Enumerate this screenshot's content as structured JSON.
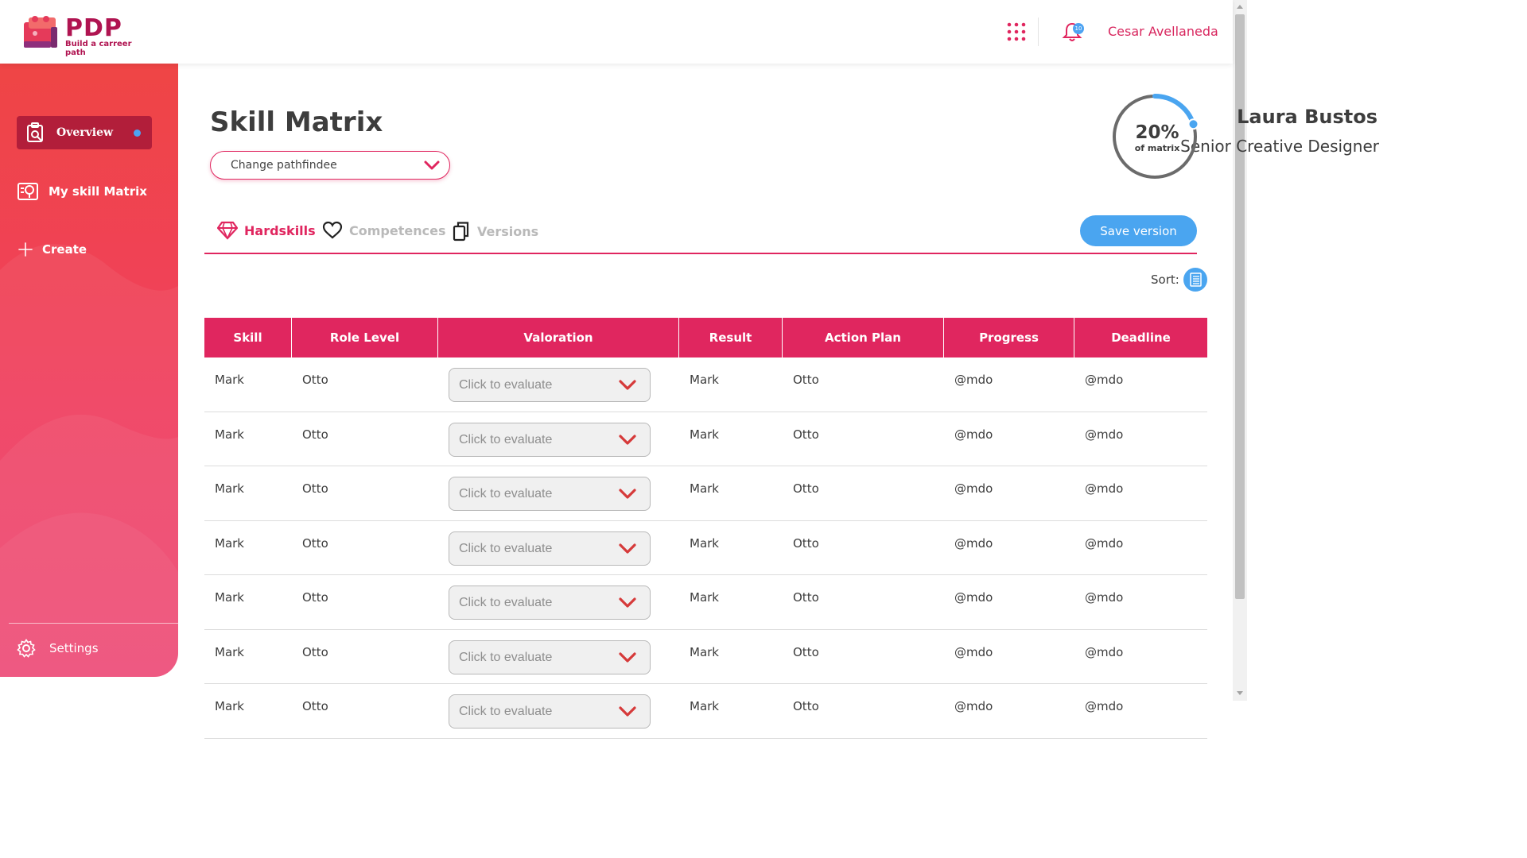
{
  "header": {
    "logo_text": "PDP",
    "logo_tagline": "Build a carreer path",
    "notification_count": "10",
    "user_name": "Cesar Avellaneda"
  },
  "sidebar": {
    "items": [
      {
        "label": "Overview",
        "active": true,
        "icon": "overview-icon"
      },
      {
        "label": "My skill Matrix",
        "active": false,
        "icon": "skill-matrix-icon"
      },
      {
        "label": "Create",
        "active": false,
        "icon": "plus-icon"
      }
    ],
    "settings_label": "Settings"
  },
  "page": {
    "title": "Skill Matrix",
    "pathfindee_placeholder": "Change pathfindee",
    "person_name": "Laura Bustos",
    "person_role": "Senior Creative Designer",
    "progress_percent_text": "20%",
    "progress_caption": "of matrix",
    "progress_fraction": 0.2
  },
  "tabs": [
    {
      "label": "Hardskills",
      "active": true,
      "icon": "diamond-icon"
    },
    {
      "label": "Competences",
      "active": false,
      "icon": "heart-icon"
    },
    {
      "label": "Versions",
      "active": false,
      "icon": "copy-icon"
    }
  ],
  "save_version_label": "Save version",
  "sort_label": "Sort:",
  "table": {
    "columns": [
      "Skill",
      "Role Level",
      "Valoration",
      "Result",
      "Action Plan",
      "Progress",
      "Deadline"
    ],
    "rows": [
      {
        "skill": "Mark",
        "role_level": "Otto",
        "valoration": "Click to evaluate",
        "result": "Mark",
        "action_plan": "Otto",
        "progress": "@mdo",
        "deadline": "@mdo"
      },
      {
        "skill": "Mark",
        "role_level": "Otto",
        "valoration": "Click to evaluate",
        "result": "Mark",
        "action_plan": "Otto",
        "progress": "@mdo",
        "deadline": "@mdo"
      },
      {
        "skill": "Mark",
        "role_level": "Otto",
        "valoration": "Click to evaluate",
        "result": "Mark",
        "action_plan": "Otto",
        "progress": "@mdo",
        "deadline": "@mdo"
      },
      {
        "skill": "Mark",
        "role_level": "Otto",
        "valoration": "Click to evaluate",
        "result": "Mark",
        "action_plan": "Otto",
        "progress": "@mdo",
        "deadline": "@mdo"
      },
      {
        "skill": "Mark",
        "role_level": "Otto",
        "valoration": "Click to evaluate",
        "result": "Mark",
        "action_plan": "Otto",
        "progress": "@mdo",
        "deadline": "@mdo"
      },
      {
        "skill": "Mark",
        "role_level": "Otto",
        "valoration": "Click to evaluate",
        "result": "Mark",
        "action_plan": "Otto",
        "progress": "@mdo",
        "deadline": "@mdo"
      },
      {
        "skill": "Mark",
        "role_level": "Otto",
        "valoration": "Click to evaluate",
        "result": "Mark",
        "action_plan": "Otto",
        "progress": "@mdo",
        "deadline": "@mdo"
      }
    ]
  },
  "colors": {
    "accent": "#e0265f",
    "sidebar_top": "#ef4545",
    "sidebar_bottom": "#ec3c6c",
    "active_nav": "#b21e3a",
    "primary_button": "#4aa5f0",
    "text_dark": "#3d3d3d"
  }
}
